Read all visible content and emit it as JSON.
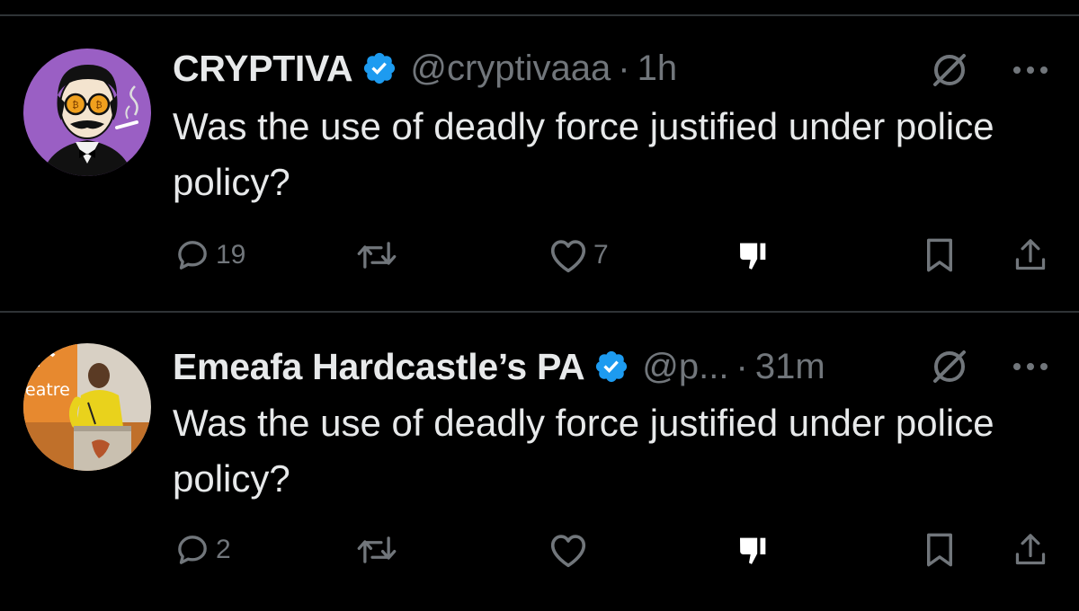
{
  "tweets": [
    {
      "name": "CRYPTIVA",
      "handle": "@cryptivaaa",
      "separator": "·",
      "time": "1h",
      "text": "Was the use of deadly force justified under police policy?",
      "verified": true,
      "avatar": "illustrated-man-with-sunglasses-avatar",
      "replies": "19",
      "reposts": "",
      "likes": "7"
    },
    {
      "name": "Emeafa Hardcastle’s PA",
      "handle": "@p...",
      "separator": "·",
      "time": "31m",
      "text": "Was the use of deadly force justified under police policy?",
      "verified": true,
      "avatar": "woman-speaking-at-podium-avatar",
      "avatar_text": "eatre",
      "replies": "2",
      "reposts": "",
      "likes": ""
    }
  ],
  "icons": {
    "verified": "verified-badge-icon",
    "grok": "grok-icon",
    "more": "more-options-icon",
    "reply": "reply-icon",
    "repost": "repost-icon",
    "like": "like-icon",
    "downvote": "downvote-icon",
    "bookmark": "bookmark-icon",
    "share": "share-icon"
  },
  "colors": {
    "background": "#000000",
    "text": "#e7e9ea",
    "secondary": "#71767b",
    "verified": "#1d9bf0",
    "divider": "#2f3336"
  }
}
